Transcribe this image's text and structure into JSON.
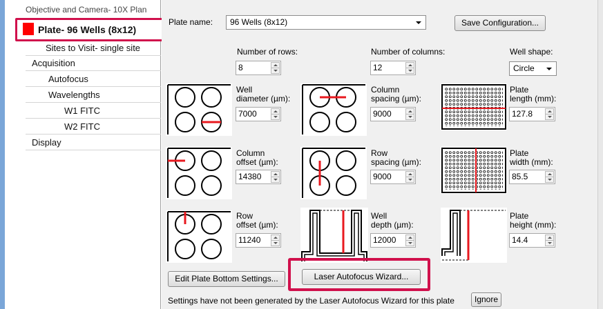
{
  "tree": {
    "items": [
      {
        "label": "Objective and Camera- 10X Plan"
      },
      {
        "label": "Plate- 96 Wells (8x12)"
      },
      {
        "label": "Sites to Visit- single site"
      },
      {
        "label": "Acquisition"
      },
      {
        "label": "Autofocus"
      },
      {
        "label": "Wavelengths"
      },
      {
        "label": "W1 FITC"
      },
      {
        "label": "W2 FITC"
      },
      {
        "label": "Display"
      }
    ]
  },
  "plate": {
    "name_label": "Plate name:",
    "name_value": "96 Wells (8x12)",
    "save_button": "Save Configuration...",
    "rows_label": "Number of rows:",
    "rows_value": "8",
    "cols_label": "Number of columns:",
    "cols_value": "12",
    "shape_label": "Well shape:",
    "shape_value": "Circle",
    "well_diameter_label1": "Well",
    "well_diameter_label2": "diameter (µm):",
    "well_diameter_value": "7000",
    "col_spacing_label1": "Column",
    "col_spacing_label2": "spacing (µm):",
    "col_spacing_value": "9000",
    "plate_length_label1": "Plate",
    "plate_length_label2": "length (mm):",
    "plate_length_value": "127.8",
    "col_offset_label1": "Column",
    "col_offset_label2": "offset (µm):",
    "col_offset_value": "14380",
    "row_spacing_label1": "Row",
    "row_spacing_label2": "spacing (µm):",
    "row_spacing_value": "9000",
    "plate_width_label1": "Plate",
    "plate_width_label2": "width (mm):",
    "plate_width_value": "85.5",
    "row_offset_label1": "Row",
    "row_offset_label2": "offset (µm):",
    "row_offset_value": "11240",
    "well_depth_label1": "Well",
    "well_depth_label2": "depth (µm):",
    "well_depth_value": "12000",
    "plate_height_label1": "Plate",
    "plate_height_label2": "height (mm):",
    "plate_height_value": "14.4",
    "edit_bottom_button": "Edit Plate Bottom Settings...",
    "laser_wizard_button": "Laser Autofocus Wizard...",
    "status_text": "Settings have not been generated by the Laser Autofocus Wizard for this plate",
    "ignore_button": "Ignore"
  },
  "colors": {
    "accent_red": "#e8191f",
    "highlight": "#d0104c"
  }
}
